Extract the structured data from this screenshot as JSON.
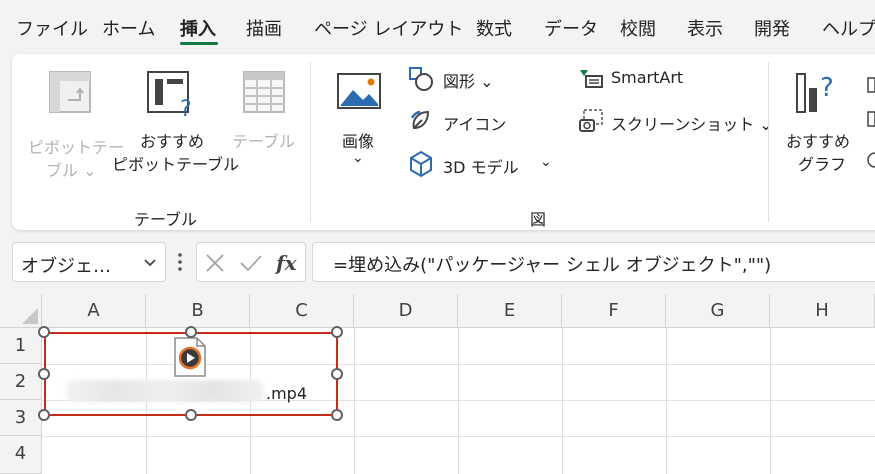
{
  "menu": {
    "tabs": [
      "ファイル",
      "ホーム",
      "挿入",
      "描画",
      "ページ レイアウト",
      "数式",
      "データ",
      "校閲",
      "表示",
      "開発",
      "ヘルプ"
    ],
    "active_tab": "挿入"
  },
  "ribbon": {
    "table_group": {
      "pivot_table": [
        "ピボットテー",
        "ブル ⌄"
      ],
      "recommended_pivot": [
        "おすすめ",
        "ピボットテーブル"
      ],
      "table": "テーブル",
      "label": "テーブル"
    },
    "illustrations_group": {
      "images": "画像",
      "images_arrow": "⌄",
      "shapes": "図形 ⌄",
      "icons": "アイコン",
      "models_3d": "3D モデル",
      "models_arrow": "⌄",
      "smartart": "SmartArt",
      "screenshot": "スクリーンショット ⌄",
      "label": "図"
    },
    "charts_group": {
      "recommended_charts": [
        "おすすめ",
        "グラフ"
      ]
    }
  },
  "formula_bar": {
    "name_box": "オブジェ…",
    "formula": "=埋め込み(\"パッケージャー シェル オブジェクト\",\"\")"
  },
  "grid": {
    "columns": [
      "A",
      "B",
      "C",
      "D",
      "E",
      "F",
      "G",
      "H"
    ],
    "rows": [
      "1",
      "2",
      "3",
      "4"
    ]
  },
  "embedded_object": {
    "file_extension": ".mp4"
  }
}
